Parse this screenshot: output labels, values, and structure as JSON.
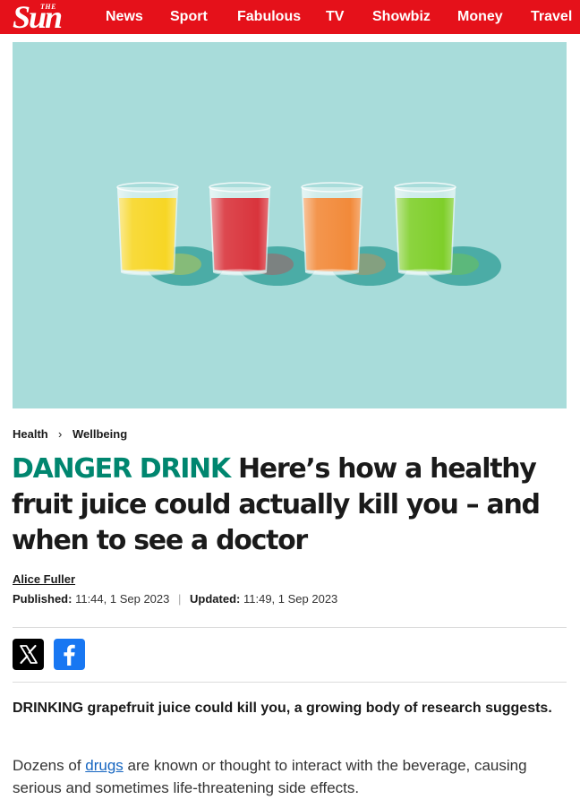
{
  "header": {
    "logo_small": "THE",
    "logo_main": "Sun",
    "nav": [
      {
        "label": "News"
      },
      {
        "label": "Sport"
      },
      {
        "label": "Fabulous"
      },
      {
        "label": "TV"
      },
      {
        "label": "Showbiz"
      },
      {
        "label": "Money"
      },
      {
        "label": "Travel"
      }
    ],
    "brand_color": "#e5111a"
  },
  "hero_image": {
    "background_color": "#a8dcda",
    "glasses": [
      {
        "juice_color": "#f7d625"
      },
      {
        "juice_color": "#d9343c"
      },
      {
        "juice_color": "#f28a3a"
      },
      {
        "juice_color": "#7fcf2a"
      }
    ]
  },
  "breadcrumb": {
    "items": [
      "Health",
      "Wellbeing"
    ],
    "separator": "›"
  },
  "article": {
    "kicker": "DANGER DRINK",
    "headline": "Here’s how a healthy fruit juice could actually kill you – and when to see a doctor",
    "kicker_color": "#00866f",
    "author": "Alice Fuller",
    "published_label": "Published:",
    "published_value": "11:44, 1 Sep 2023",
    "date_separator": "|",
    "updated_label": "Updated:",
    "updated_value": "11:49, 1 Sep 2023",
    "share": [
      {
        "icon": "x-icon"
      },
      {
        "icon": "facebook-icon"
      }
    ],
    "lead": "DRINKING grapefruit juice could kill you, a growing body of research suggests.",
    "para1": {
      "before": "Dozens of ",
      "link": "drugs",
      "after": " are known or thought to interact with the beverage, causing serious and sometimes life-threatening side effects."
    }
  }
}
